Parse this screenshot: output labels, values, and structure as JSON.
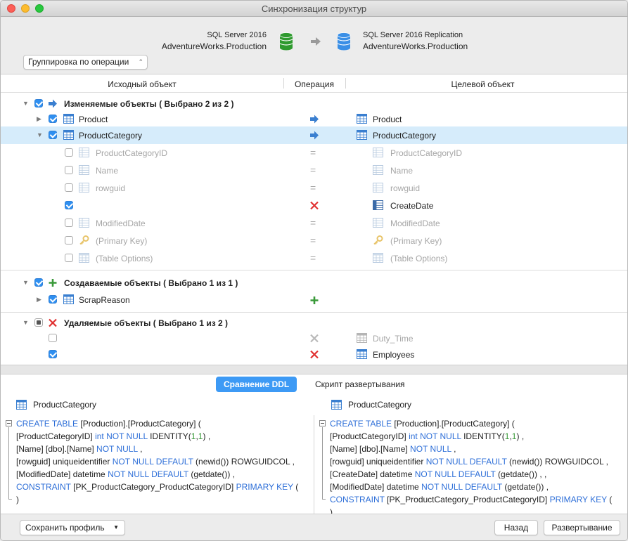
{
  "window": {
    "title": "Синхронизация структур"
  },
  "header": {
    "source": {
      "server": "SQL Server 2016",
      "database": "AdventureWorks.Production"
    },
    "target": {
      "server": "SQL Server 2016 Replication",
      "database": "AdventureWorks.Production"
    },
    "grouping_select": "Группировка по операции"
  },
  "columns": {
    "source": "Исходный объект",
    "operation": "Операция",
    "target": "Целевой объект"
  },
  "groups": {
    "modified": {
      "label": "Изменяемые объекты ( Выбрано 2 из 2 )"
    },
    "created": {
      "label": "Создаваемые объекты ( Выбрано 1 из 1 )"
    },
    "deleted": {
      "label": "Удаляемые объекты ( Выбрано 1 из 2 )"
    }
  },
  "rows": {
    "product": {
      "source": "Product",
      "target": "Product"
    },
    "productcategory": {
      "source": "ProductCategory",
      "target": "ProductCategory"
    },
    "pcid": {
      "source": "ProductCategoryID",
      "target": "ProductCategoryID"
    },
    "name": {
      "source": "Name",
      "target": "Name"
    },
    "rowguid": {
      "source": "rowguid",
      "target": "rowguid"
    },
    "createdate": {
      "source": "",
      "target": "CreateDate"
    },
    "modifieddate": {
      "source": "ModifiedDate",
      "target": "ModifiedDate"
    },
    "primarykey": {
      "source": "(Primary Key)",
      "target": "(Primary Key)"
    },
    "tableoptions": {
      "source": "(Table Options)",
      "target": "(Table Options)"
    },
    "scrapreason": {
      "source": "ScrapReason",
      "target": ""
    },
    "dutytime": {
      "source": "",
      "target": "Duty_Time"
    },
    "employees": {
      "source": "",
      "target": "Employees"
    }
  },
  "ddl": {
    "tabs": {
      "compare": "Сравнение DDL",
      "script": "Скрипт развертывания"
    },
    "left": {
      "title": "ProductCategory",
      "lines": [
        [
          "CREATE TABLE",
          " [Production].[ProductCategory] ("
        ],
        [
          "[ProductCategoryID] ",
          "int NOT NULL",
          " IDENTITY(",
          "1",
          ",",
          "1",
          ") ,"
        ],
        [
          "[Name] [dbo].[Name] ",
          "NOT NULL",
          " ,"
        ],
        [
          "[rowguid] uniqueidentifier ",
          "NOT NULL DEFAULT",
          " (newid()) ROWGUIDCOL ,"
        ],
        [
          "[ModifiedDate] datetime ",
          "NOT NULL DEFAULT",
          " (getdate()) ,"
        ],
        [
          "CONSTRAINT",
          " [PK_ProductCategory_ProductCategoryID] ",
          "PRIMARY KEY",
          " ("
        ],
        [
          ")"
        ]
      ]
    },
    "right": {
      "title": "ProductCategory",
      "lines": [
        [
          "CREATE TABLE",
          " [Production].[ProductCategory] ("
        ],
        [
          "[ProductCategoryID] ",
          "int NOT NULL",
          " IDENTITY(",
          "1",
          ",",
          "1",
          ") ,"
        ],
        [
          "[Name] [dbo].[Name] ",
          "NOT NULL",
          " ,"
        ],
        [
          "[rowguid] uniqueidentifier ",
          "NOT NULL DEFAULT",
          " (newid()) ROWGUIDCOL ,"
        ],
        [
          "[CreateDate] datetime ",
          "NOT NULL DEFAULT",
          " (getdate()) , ,"
        ],
        [
          "[ModifiedDate] datetime ",
          "NOT NULL DEFAULT",
          " (getdate()) ,"
        ],
        [
          "CONSTRAINT",
          " [PK_ProductCategory_ProductCategoryID] ",
          "PRIMARY KEY",
          " ("
        ],
        [
          ")"
        ]
      ]
    }
  },
  "footer": {
    "save_profile": "Сохранить профиль",
    "back": "Назад",
    "deploy": "Развертывание"
  },
  "colors": {
    "accent": "#3d9af5",
    "selection": "#d6ecfb",
    "source_db": "#2f9a2f",
    "target_db": "#3a8fe6",
    "keyword": "#2e6fd8",
    "delete": "#e03030",
    "add": "#3a9a3a"
  }
}
